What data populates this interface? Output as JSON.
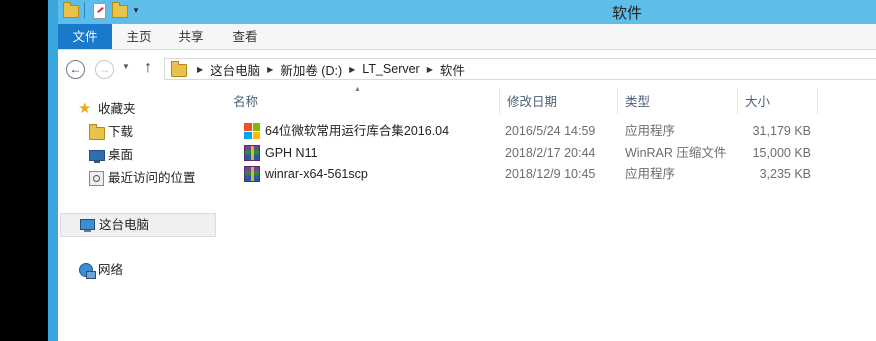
{
  "window": {
    "title": "软件"
  },
  "ribbon": {
    "tabs": [
      {
        "label": "文件"
      },
      {
        "label": "主页"
      },
      {
        "label": "共享"
      },
      {
        "label": "查看"
      }
    ]
  },
  "address": {
    "breadcrumbs": [
      "这台电脑",
      "新加卷 (D:)",
      "LT_Server",
      "软件"
    ]
  },
  "navpane": {
    "favorites_label": "收藏夹",
    "favorites": [
      {
        "label": "下载",
        "icon": "downloads-folder-icon"
      },
      {
        "label": "桌面",
        "icon": "desktop-icon"
      },
      {
        "label": "最近访问的位置",
        "icon": "recent-places-icon"
      }
    ],
    "this_pc_label": "这台电脑",
    "network_label": "网络"
  },
  "list": {
    "columns": {
      "name": "名称",
      "date": "修改日期",
      "type": "类型",
      "size": "大小"
    },
    "files": [
      {
        "name": "64位微软常用运行库合集2016.04",
        "date": "2016/5/24 14:59",
        "type": "应用程序",
        "size": "31,179 KB",
        "icon": "windows-installer-icon"
      },
      {
        "name": "GPH N11",
        "date": "2018/2/17 20:44",
        "type": "WinRAR 压缩文件",
        "size": "15,000 KB",
        "icon": "winrar-archive-icon"
      },
      {
        "name": "winrar-x64-561scp",
        "date": "2018/12/9 10:45",
        "type": "应用程序",
        "size": "3,235 KB",
        "icon": "winrar-setup-icon"
      }
    ]
  }
}
